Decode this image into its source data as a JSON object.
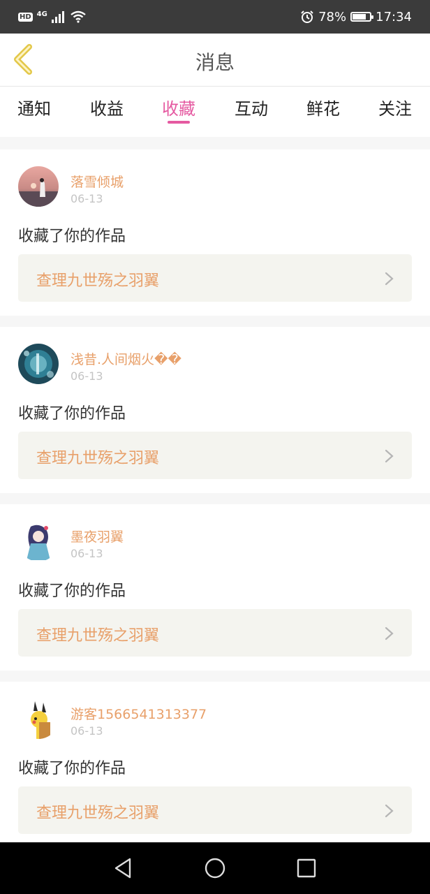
{
  "status_bar": {
    "hd": "HD",
    "network": "4G",
    "battery_percent": "78%",
    "battery_level": 0.78,
    "time": "17:34"
  },
  "header": {
    "title": "消息"
  },
  "tabs": [
    {
      "label": "通知"
    },
    {
      "label": "收益"
    },
    {
      "label": "收藏",
      "active": true
    },
    {
      "label": "互动"
    },
    {
      "label": "鲜花"
    },
    {
      "label": "关注"
    }
  ],
  "notifications": [
    {
      "username": "落雪倾城",
      "date": "06-13",
      "action": "收藏了你的作品",
      "work_title": "查理九世殇之羽翼"
    },
    {
      "username": "浅昔.人间烟火��",
      "date": "06-13",
      "action": "收藏了你的作品",
      "work_title": "查理九世殇之羽翼"
    },
    {
      "username": "墨夜羽翼",
      "date": "06-13",
      "action": "收藏了你的作品",
      "work_title": "查理九世殇之羽翼"
    },
    {
      "username": "游客1566541313377",
      "date": "06-13",
      "action": "收藏了你的作品",
      "work_title": "查理九世殇之羽翼"
    }
  ],
  "colors": {
    "accent": "#e55aa1",
    "username": "#e8a06a",
    "back_arrow": "#e3c84a"
  }
}
